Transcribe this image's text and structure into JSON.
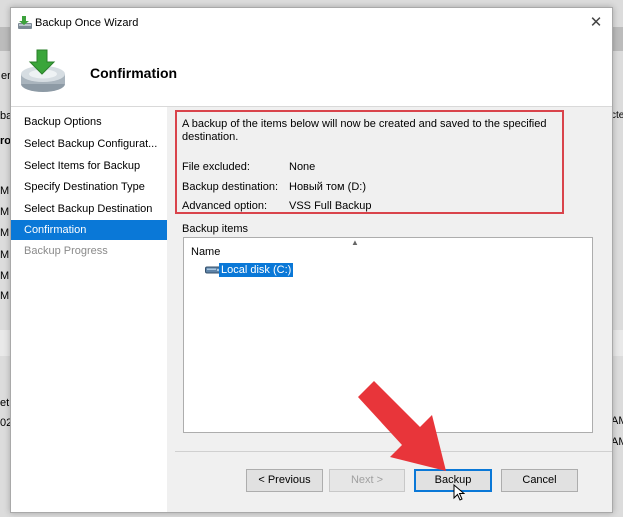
{
  "window": {
    "title": "Backup Once Wizard"
  },
  "header": {
    "title": "Confirmation"
  },
  "nav": {
    "items": [
      {
        "label": "Backup Options"
      },
      {
        "label": "Select Backup Configurat..."
      },
      {
        "label": "Select Items for Backup"
      },
      {
        "label": "Specify Destination Type"
      },
      {
        "label": "Select Backup Destination"
      },
      {
        "label": "Confirmation"
      },
      {
        "label": "Backup Progress"
      }
    ],
    "active_index": 5
  },
  "summary": {
    "intro": "A backup of the items below will now be created and saved to the specified destination.",
    "rows": [
      {
        "label": "File excluded:",
        "value": "None"
      },
      {
        "label": "Backup destination:",
        "value": "Новый том (D:)"
      },
      {
        "label": "Advanced option:",
        "value": "VSS Full Backup"
      }
    ]
  },
  "items": {
    "label": "Backup items",
    "column": "Name",
    "entries": [
      {
        "label": "Local disk (C:)",
        "icon": "drive-icon"
      }
    ]
  },
  "buttons": {
    "previous": "< Previous",
    "next": "Next >",
    "backup": "Backup",
    "cancel": "Cancel"
  },
  "background": {
    "left_fragments": [
      "er",
      "ba",
      "ro",
      "M",
      "M",
      "M",
      "M",
      "M",
      "M",
      "et",
      "02"
    ],
    "right_fragments": [
      "cted",
      "AM",
      "AM"
    ]
  },
  "colors": {
    "accent": "#0a78d7",
    "highlight_box": "#d9434b",
    "arrow": "#e8353a"
  }
}
